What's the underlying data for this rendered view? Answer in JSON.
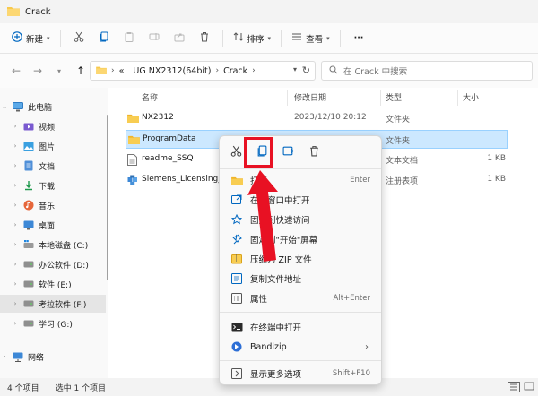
{
  "window": {
    "title": "Crack"
  },
  "toolbar": {
    "new_label": "新建",
    "sort_label": "排序",
    "view_label": "查看",
    "more_label": "···"
  },
  "address": {
    "crumbs": [
      "«",
      "UG NX2312(64bit)",
      "Crack"
    ],
    "search_placeholder": "在 Crack 中搜索"
  },
  "sidebar": {
    "items": [
      {
        "label": "此电脑",
        "icon": "pc-icon"
      },
      {
        "label": "视频",
        "icon": "video-icon"
      },
      {
        "label": "图片",
        "icon": "picture-icon"
      },
      {
        "label": "文档",
        "icon": "document-icon"
      },
      {
        "label": "下载",
        "icon": "download-icon"
      },
      {
        "label": "音乐",
        "icon": "music-icon"
      },
      {
        "label": "桌面",
        "icon": "desktop-icon"
      },
      {
        "label": "本地磁盘 (C:)",
        "icon": "drive-icon"
      },
      {
        "label": "办公软件 (D:)",
        "icon": "drive-icon"
      },
      {
        "label": "软件 (E:)",
        "icon": "drive-icon"
      },
      {
        "label": "考拉软件 (F:)",
        "icon": "drive-icon"
      },
      {
        "label": "学习 (G:)",
        "icon": "drive-icon"
      },
      {
        "label": "网络",
        "icon": "network-icon"
      }
    ]
  },
  "columns": {
    "name": "名称",
    "date": "修改日期",
    "type": "类型",
    "size": "大小"
  },
  "files": [
    {
      "name": "NX2312",
      "date": "2023/12/10 20:12",
      "type": "文件夹",
      "size": "",
      "icon": "folder-icon"
    },
    {
      "name": "ProgramData",
      "date": "",
      "type": "文件夹",
      "size": "",
      "icon": "folder-icon"
    },
    {
      "name": "readme_SSQ",
      "date": "",
      "type": "文本文档",
      "size": "1 KB",
      "icon": "text-file-icon"
    },
    {
      "name": "Siemens_Licensing_S",
      "date": "",
      "type": "注册表项",
      "size": "1 KB",
      "icon": "registry-file-icon"
    }
  ],
  "context_menu": {
    "items": [
      {
        "label": "打开",
        "shortcut": "Enter",
        "icon": "open-folder-icon"
      },
      {
        "label": "在新窗口中打开",
        "shortcut": "",
        "icon": "new-window-icon"
      },
      {
        "label": "固定到快速访问",
        "shortcut": "",
        "icon": "pin-star-icon"
      },
      {
        "label": "固定到\"开始\"屏幕",
        "shortcut": "",
        "icon": "pin-icon"
      },
      {
        "label": "压缩为 ZIP 文件",
        "shortcut": "",
        "icon": "zip-icon"
      },
      {
        "label": "复制文件地址",
        "shortcut": "",
        "icon": "copy-path-icon"
      },
      {
        "label": "属性",
        "shortcut": "Alt+Enter",
        "icon": "properties-icon"
      },
      {
        "label": "在终端中打开",
        "shortcut": "",
        "icon": "terminal-icon"
      },
      {
        "label": "Bandizip",
        "shortcut": "",
        "icon": "bandizip-icon"
      },
      {
        "label": "显示更多选项",
        "shortcut": "Shift+F10",
        "icon": "more-options-icon"
      }
    ]
  },
  "status": {
    "item_count": "4 个项目",
    "selected": "选中 1 个项目"
  },
  "colors": {
    "accent": "#0067c0",
    "selection": "#cce8ff",
    "folder": "#f8c94b",
    "highlight": "#e81123"
  }
}
